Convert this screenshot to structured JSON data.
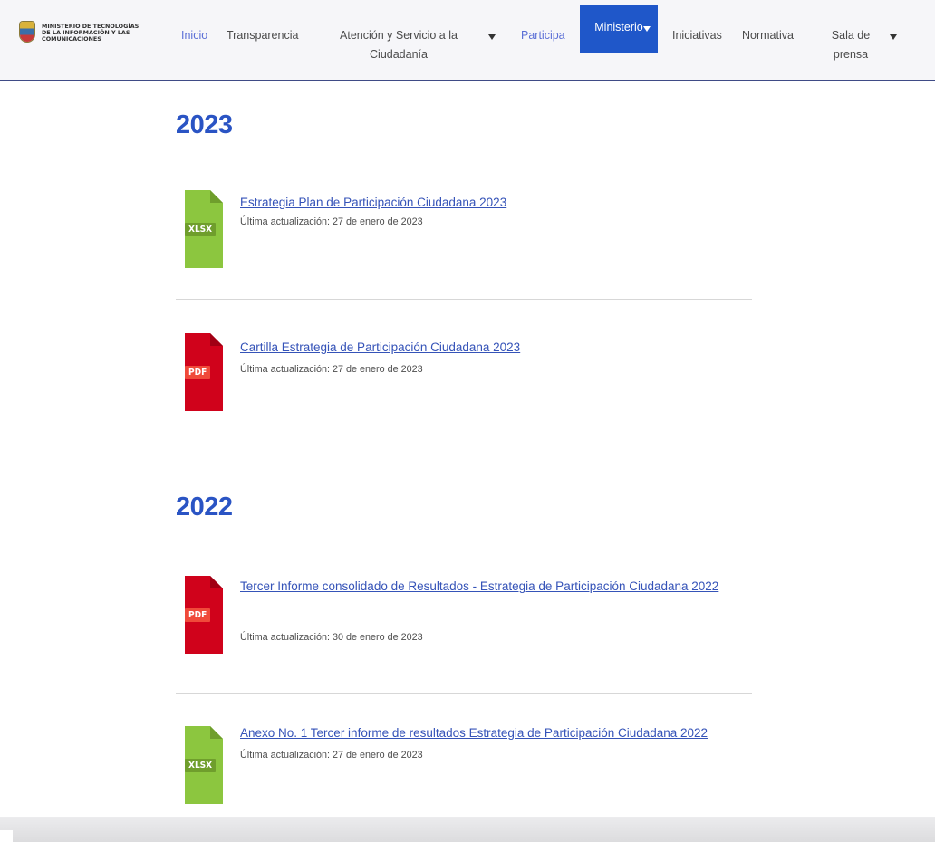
{
  "logo": {
    "text": "MINISTERIO DE TECNOLOGÍAS DE LA INFORMACIÓN Y LAS COMUNICACIONES",
    "icon": "colombia-coat-of-arms-icon"
  },
  "nav": {
    "inicio": "Inicio",
    "transparencia": "Transparencia",
    "atencion": "Atención y Servicio a la Ciudadanía",
    "participa": "Participa",
    "ministerio": "Ministerio",
    "iniciativas": "Iniciativas",
    "normativa": "Normativa",
    "sala": "Sala de prensa"
  },
  "colors": {
    "accent": "#1f57c9",
    "heading": "#2a54c4",
    "xlsx": "#8cc63f",
    "pdf": "#d0021b"
  },
  "sections": [
    {
      "year": "2023",
      "docs": [
        {
          "type": "XLSX",
          "title": "Estrategia Plan de Participación Ciudadana 2023",
          "meta": "Última actualización: 27 de enero de 2023"
        },
        {
          "type": "PDF",
          "title": "Cartilla Estrategia de Participación Ciudadana 2023",
          "meta": "Última actualización: 27 de enero de 2023"
        }
      ]
    },
    {
      "year": "2022",
      "docs": [
        {
          "type": "PDF",
          "title": "Tercer Informe consolidado de Resultados - Estrategia de Participación Ciudadana 2022",
          "meta": "Última actualización: 30 de enero de 2023"
        },
        {
          "type": "XLSX",
          "title": "Anexo No. 1 Tercer informe de resultados Estrategia de Participación Ciudadana 2022",
          "meta": "Última actualización: 27 de enero de 2023"
        }
      ]
    }
  ]
}
